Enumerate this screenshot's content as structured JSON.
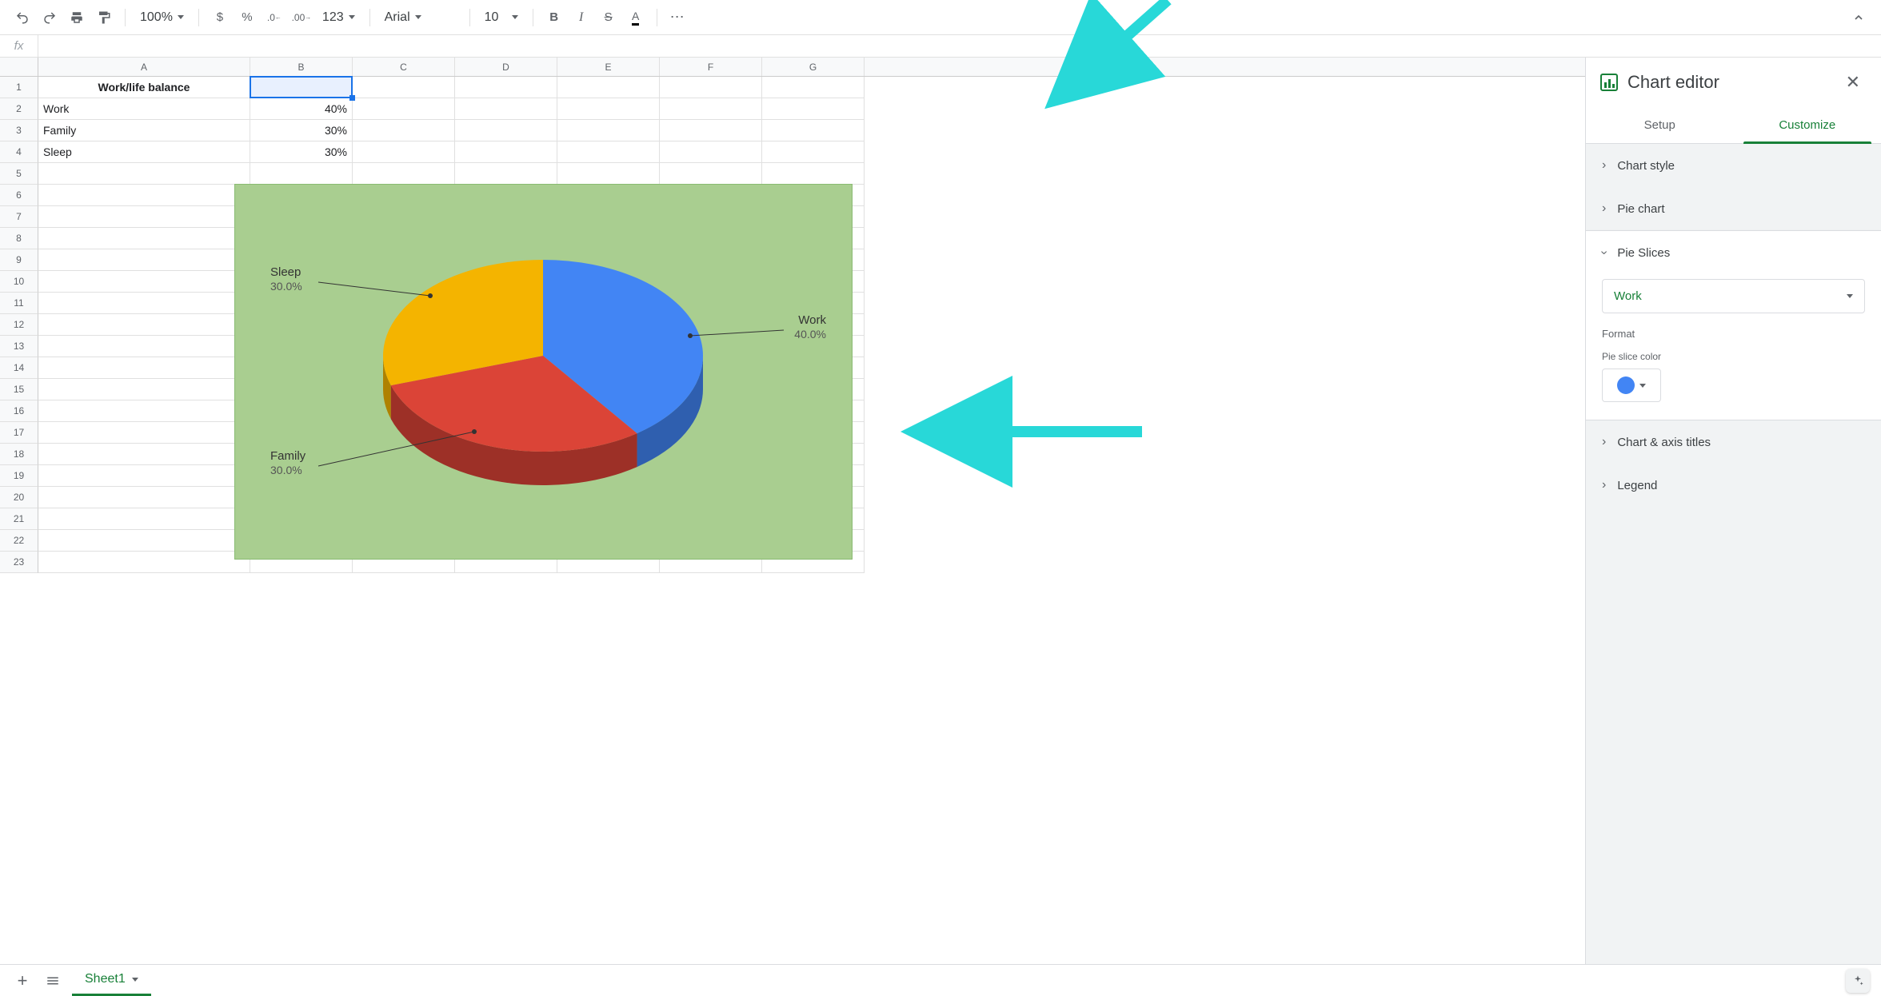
{
  "toolbar": {
    "zoom": "100%",
    "font": "Arial",
    "fontSize": "10",
    "numberFormat": "123"
  },
  "formulaBar": {
    "fx": "fx",
    "value": ""
  },
  "columns": [
    "A",
    "B",
    "C",
    "D",
    "E",
    "F",
    "G"
  ],
  "rowCount": 23,
  "cells": {
    "A1": "Work/life balance",
    "A2": "Work",
    "B2": "40%",
    "A3": "Family",
    "B3": "30%",
    "A4": "Sleep",
    "B4": "30%"
  },
  "selectedCell": "B1",
  "chart_data": {
    "type": "pie",
    "title": "",
    "categories": [
      "Work",
      "Family",
      "Sleep"
    ],
    "values": [
      40.0,
      30.0,
      30.0
    ],
    "labels": [
      "Work\n40.0%",
      "Family\n30.0%",
      "Sleep\n30.0%"
    ],
    "colors": [
      "#4285F4",
      "#DB4437",
      "#F4B400"
    ],
    "is3d": true,
    "background": "#a9ce90"
  },
  "panel": {
    "title": "Chart editor",
    "tabs": {
      "setup": "Setup",
      "customize": "Customize"
    },
    "activeTab": "customize",
    "sections": {
      "chartStyle": "Chart style",
      "pieChart": "Pie chart",
      "pieSlices": "Pie Slices",
      "chartAxisTitles": "Chart & axis titles",
      "legend": "Legend"
    },
    "pieSlices": {
      "selected": "Work",
      "formatLabel": "Format",
      "colorLabel": "Pie slice color",
      "color": "#4285F4"
    }
  },
  "sheetTabs": {
    "active": "Sheet1"
  }
}
